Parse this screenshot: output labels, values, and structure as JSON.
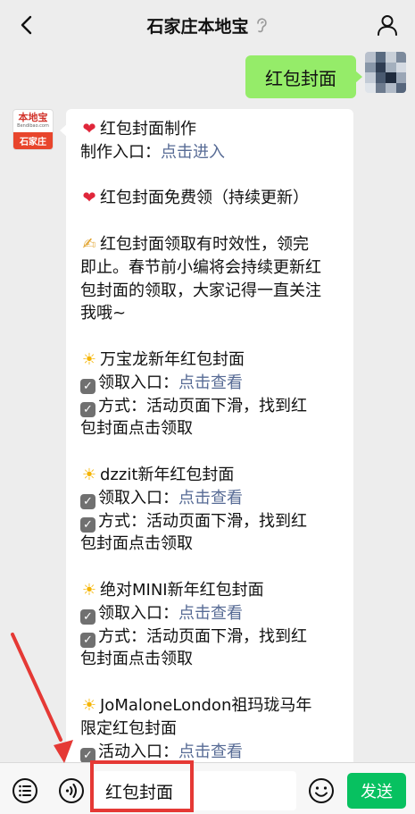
{
  "header": {
    "title": "石家庄本地宝",
    "back_icon": "chevron-left-icon",
    "profile_icon": "person-icon",
    "notify_icon": "ear-icon"
  },
  "chat": {
    "my_message": {
      "text": "红包封面"
    },
    "bot": {
      "avatar": {
        "logo_text": "本地宝",
        "logo_sub": "Bendibao.com",
        "city": "石家庄"
      },
      "lines": [
        {
          "emoji": "❤",
          "text": "红包封面制作"
        },
        {
          "text": "制作入口：",
          "link": "点击进入"
        },
        {
          "gap": true
        },
        {
          "emoji": "❤",
          "text": "红包封面免费领（持续更新）"
        },
        {
          "gap": true
        },
        {
          "emoji": "✍",
          "text": "红包封面领取有时效性，领完"
        },
        {
          "text": "即止。春节前小编将会持续更新红"
        },
        {
          "text": "包封面的领取，大家记得一直关注"
        },
        {
          "text": "我哦~"
        },
        {
          "gap": true
        },
        {
          "emoji": "☀",
          "text": "万宝龙新年红包封面"
        },
        {
          "check": true,
          "text": "领取入口：",
          "link": "点击查看"
        },
        {
          "check": true,
          "text": "方式：活动页面下滑，找到红"
        },
        {
          "text": "包封面点击领取"
        },
        {
          "gap": true
        },
        {
          "emoji": "☀",
          "text": "dzzit新年红包封面"
        },
        {
          "check": true,
          "text": "领取入口：",
          "link": "点击查看"
        },
        {
          "check": true,
          "text": "方式：活动页面下滑，找到红"
        },
        {
          "text": "包封面点击领取"
        },
        {
          "gap": true
        },
        {
          "emoji": "☀",
          "text": "绝对MINI新年红包封面"
        },
        {
          "check": true,
          "text": "领取入口：",
          "link": "点击查看"
        },
        {
          "check": true,
          "text": "方式：活动页面下滑，找到红"
        },
        {
          "text": "包封面点击领取"
        },
        {
          "gap": true
        },
        {
          "emoji": "☀",
          "text": "JoMaloneLondon祖玛珑马年"
        },
        {
          "text": "限定红包封面"
        },
        {
          "check": true,
          "text": "活动入口：",
          "link": "点击查看"
        }
      ]
    }
  },
  "input_bar": {
    "menu_icon": "menu-list-icon",
    "voice_icon": "voice-icon",
    "input_value": "红包封面",
    "emoji_icon": "emoji-icon",
    "send_label": "发送"
  },
  "colors": {
    "accent_green": "#07c160",
    "my_bubble": "#95ec69",
    "link": "#576b95",
    "annotation_red": "#e53935"
  }
}
